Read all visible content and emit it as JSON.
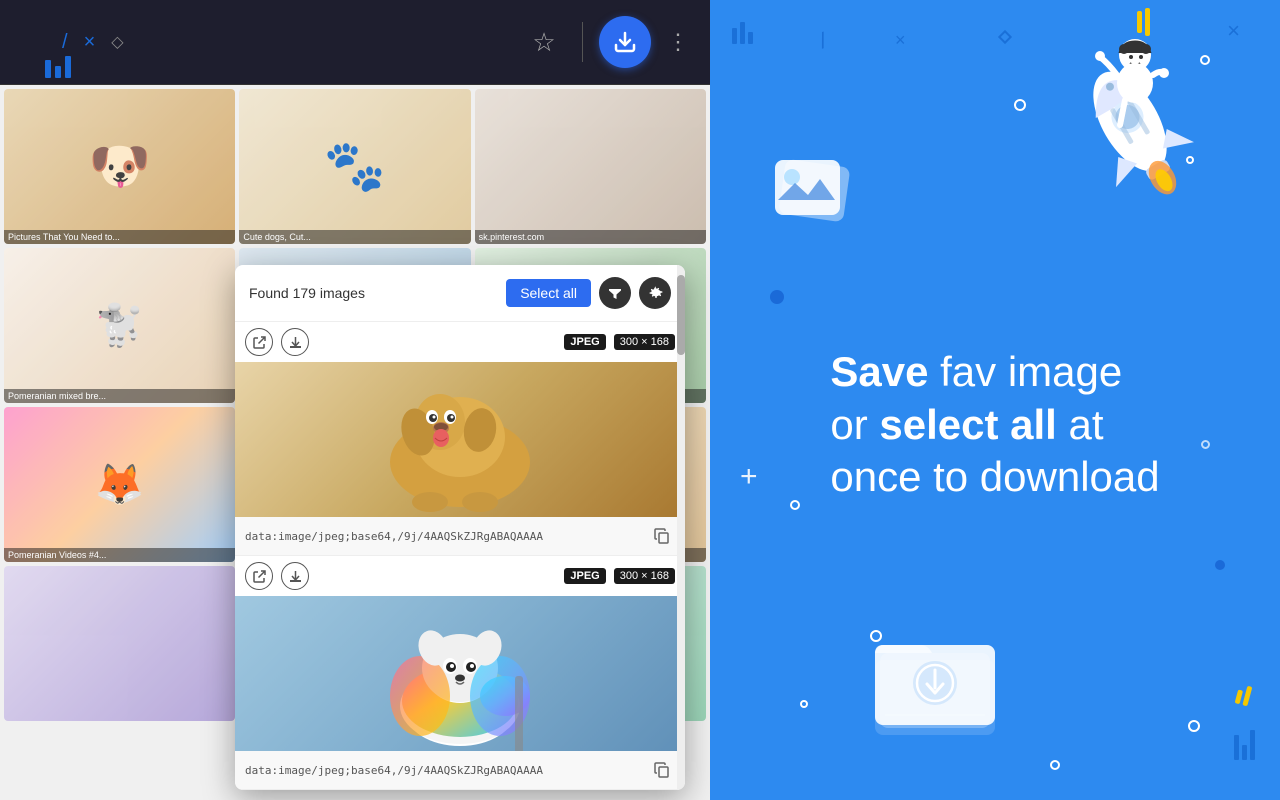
{
  "browser": {
    "bar_icon1": "≡",
    "bar_icon2": "/",
    "bar_icon3": "×",
    "bar_icon4": "◇",
    "star_label": "☆",
    "three_dots": "⋮"
  },
  "popup": {
    "found_text": "Found 179 images",
    "select_all_label": "Select all",
    "image1": {
      "format": "JPEG",
      "size": "300 × 168",
      "url": "data:image/jpeg;base64,/9j/4AAQSkZJRgABAQAAAA"
    },
    "image2": {
      "format": "JPEG",
      "size": "300 × 168",
      "url": "data:image/jpeg;base64,/9j/4AAQSkZJRgABAQAAAA"
    }
  },
  "right_panel": {
    "hero_line1": " fav image",
    "hero_save": "Save",
    "hero_line2": "or ",
    "hero_select": "select all",
    "hero_line3": " at",
    "hero_line4": "once to download"
  },
  "decorations": {
    "close_label": "×",
    "plus_label": "+"
  }
}
